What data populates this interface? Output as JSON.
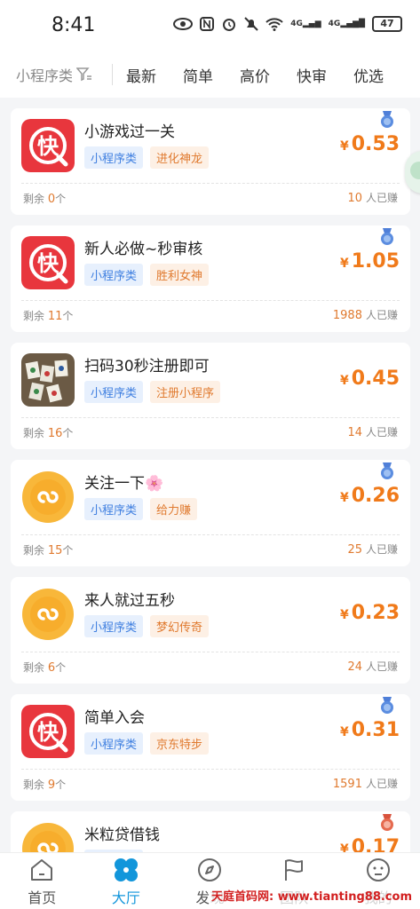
{
  "status_bar": {
    "time": "8:41",
    "battery": "47",
    "signal1": "4G",
    "signal2": "4G"
  },
  "filter_bar": {
    "category_label": "小程序类",
    "tabs": [
      "最新",
      "简单",
      "高价",
      "快审",
      "优选"
    ]
  },
  "tasks": [
    {
      "title": "小游戏过一关",
      "tags": [
        "小程序类",
        "进化神龙"
      ],
      "price_symbol": "¥",
      "price": "0.53",
      "remain_prefix": "剩余",
      "remain": "0",
      "remain_suffix": "个",
      "earned": "10",
      "earned_suffix": "人已赚",
      "icon": "kuai-app-icon",
      "badge": "blue-medal-icon"
    },
    {
      "title": "新人必做~秒审核",
      "tags": [
        "小程序类",
        "胜利女神"
      ],
      "price_symbol": "¥",
      "price": "1.05",
      "remain_prefix": "剩余",
      "remain": "11",
      "remain_suffix": "个",
      "earned": "1988",
      "earned_suffix": "人已赚",
      "icon": "kuai-app-icon",
      "badge": "blue-medal-icon"
    },
    {
      "title": "扫码30秒注册即可",
      "tags": [
        "小程序类",
        "注册小程序"
      ],
      "price_symbol": "¥",
      "price": "0.45",
      "remain_prefix": "剩余",
      "remain": "16",
      "remain_suffix": "个",
      "earned": "14",
      "earned_suffix": "人已赚",
      "icon": "mahjong-photo-icon",
      "badge": ""
    },
    {
      "title": "关注一下🌸",
      "tags": [
        "小程序类",
        "给力赚"
      ],
      "price_symbol": "¥",
      "price": "0.26",
      "remain_prefix": "剩余",
      "remain": "15",
      "remain_suffix": "个",
      "earned": "25",
      "earned_suffix": "人已赚",
      "icon": "mini-program-icon",
      "badge": "blue-medal-icon"
    },
    {
      "title": "来人就过五秒",
      "tags": [
        "小程序类",
        "梦幻传奇"
      ],
      "price_symbol": "¥",
      "price": "0.23",
      "remain_prefix": "剩余",
      "remain": "6",
      "remain_suffix": "个",
      "earned": "24",
      "earned_suffix": "人已赚",
      "icon": "mini-program-icon",
      "badge": ""
    },
    {
      "title": "简单入会",
      "tags": [
        "小程序类",
        "京东特步"
      ],
      "price_symbol": "¥",
      "price": "0.31",
      "remain_prefix": "剩余",
      "remain": "9",
      "remain_suffix": "个",
      "earned": "1591",
      "earned_suffix": "人已赚",
      "icon": "kuai-app-icon",
      "badge": "blue-medal-icon"
    },
    {
      "title": "米粒贷借钱",
      "tags": [
        "小程序类",
        ""
      ],
      "price_symbol": "¥",
      "price": "0.17",
      "remain_prefix": "",
      "remain": "",
      "remain_suffix": "",
      "earned": "",
      "earned_suffix": "",
      "icon": "mini-program-icon",
      "badge": "red-medal-icon"
    }
  ],
  "bottom_nav": [
    {
      "label": "首页",
      "icon": "home-icon"
    },
    {
      "label": "大厅",
      "icon": "hall-icon"
    },
    {
      "label": "发现",
      "icon": "compass-icon"
    },
    {
      "label": "团队",
      "icon": "flag-icon"
    },
    {
      "label": "我的",
      "icon": "profile-icon"
    }
  ],
  "watermark": "天庭首码网: www.tianting88.com",
  "colors": {
    "accent": "#1296db",
    "price": "#f07a1a",
    "kuai_red": "#e8363d",
    "mini_yellow": "#f8b73a"
  }
}
